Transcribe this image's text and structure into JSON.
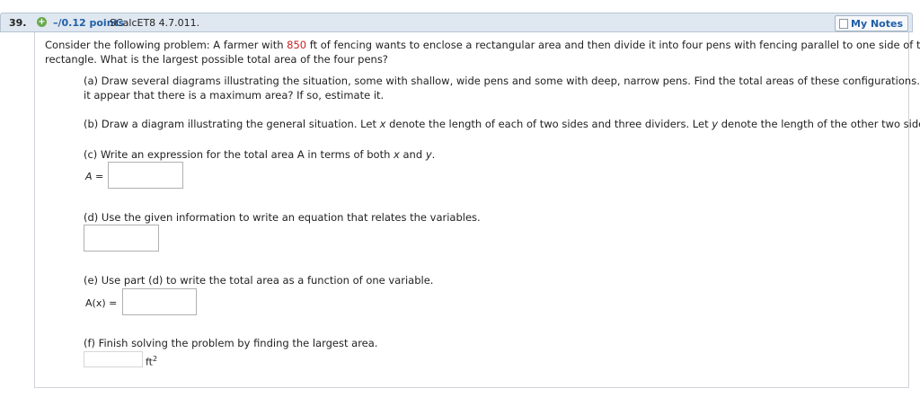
{
  "header": {
    "number": "39.",
    "plus_icon": "plus-circle-icon",
    "points": "–/0.12 points",
    "source": "SCalcET8 4.7.011.",
    "my_notes_label": "My Notes",
    "note_icon": "note-icon"
  },
  "problem": {
    "intro_a": "Consider the following problem: A farmer with ",
    "fencing_value": "850",
    "intro_b": " ft of fencing wants to enclose a rectangular area and then divide it into four pens with fencing parallel to one side of the",
    "intro_line2": "rectangle. What is the largest possible total area of the four pens?"
  },
  "parts": {
    "a_line1": "(a) Draw several diagrams illustrating the situation, some with shallow, wide pens and some with deep, narrow pens. Find the total areas of these configurations. Does",
    "a_line2": "it appear that there is a maximum area? If so, estimate it.",
    "b_pre": "(b) Draw a diagram illustrating the general situation. Let ",
    "b_x": "x",
    "b_mid": " denote the length of each of two sides and three dividers. Let ",
    "b_y": "y",
    "b_post": " denote the length of the other two sides.",
    "c_pre": "(c) Write an expression for the total area A in terms of both ",
    "c_x": "x",
    "c_and": " and ",
    "c_y": "y",
    "c_dot": ".",
    "c_label": "A =",
    "c_value": "",
    "d_text": "(d) Use the given information to write an equation that relates the variables.",
    "d_value": "",
    "e_text": "(e) Use part (d) to write the total area as a function of one variable.",
    "e_label": "A(x) =",
    "e_value": "",
    "f_text": "(f) Finish solving the problem by finding the largest area.",
    "f_value": "",
    "f_unit": "ft",
    "f_exp": "2"
  }
}
